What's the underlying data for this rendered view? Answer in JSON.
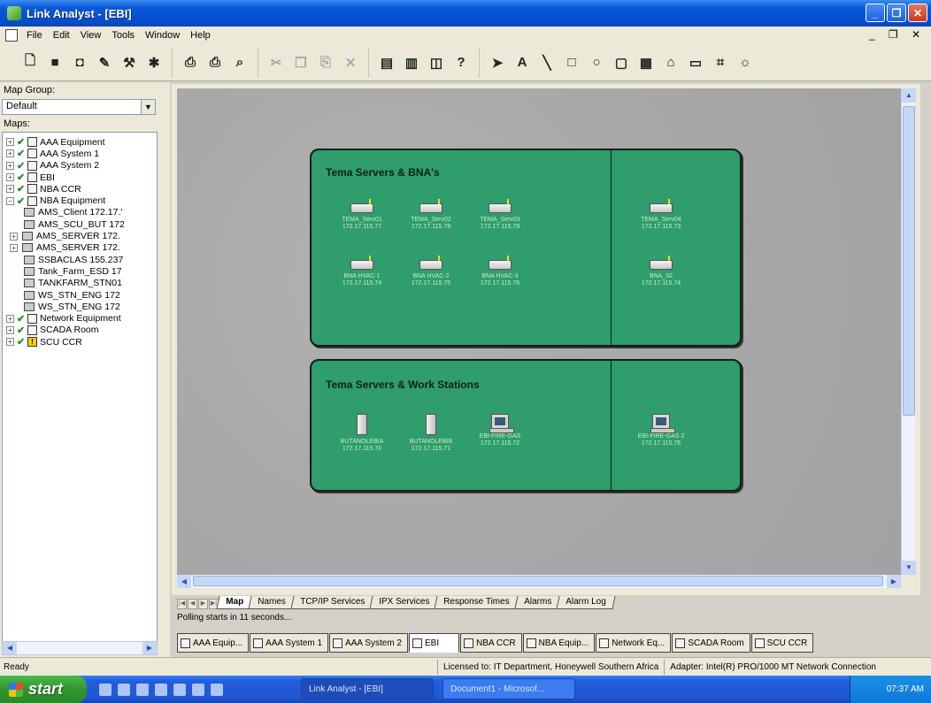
{
  "window": {
    "title": "Link Analyst - [EBI]",
    "buttons": [
      "_",
      "❐",
      "✕"
    ]
  },
  "menu": {
    "items": [
      "File",
      "Edit",
      "View",
      "Tools",
      "Window",
      "Help"
    ],
    "mdi_controls": "_ ❐ ✕"
  },
  "toolbar": {
    "groups": [
      [
        "new-icon",
        "save-icon",
        "open-icon",
        "wand-icon",
        "tools-icon",
        "discover-icon"
      ],
      [
        "print-setup-icon",
        "print-icon",
        "print-preview-icon"
      ],
      [
        "cut-icon",
        "copy-icon",
        "paste-icon",
        "delete-icon"
      ],
      [
        "layout1-icon",
        "layout2-icon",
        "layout3-icon",
        "properties-icon"
      ],
      [
        "pointer-icon",
        "text-icon",
        "line-icon",
        "rectangle-icon",
        "ellipse-icon",
        "rounded-rect-icon",
        "device-icon",
        "network-icon",
        "panel-icon",
        "grid-icon",
        "gear-icon"
      ]
    ]
  },
  "left_panel": {
    "map_group_label": "Map Group:",
    "map_group_value": "Default",
    "maps_label": "Maps:",
    "tree": [
      {
        "label": "AAA Equipment",
        "level": 0,
        "expander": "+",
        "type": "map",
        "checked": true
      },
      {
        "label": "AAA System 1",
        "level": 0,
        "expander": "+",
        "type": "map",
        "checked": true
      },
      {
        "label": "AAA System 2",
        "level": 0,
        "expander": "+",
        "type": "map",
        "checked": true
      },
      {
        "label": "EBI",
        "level": 0,
        "expander": "+",
        "type": "map",
        "checked": true
      },
      {
        "label": "NBA CCR",
        "level": 0,
        "expander": "+",
        "type": "map",
        "checked": true
      },
      {
        "label": "NBA Equipment",
        "level": 0,
        "expander": "−",
        "type": "map",
        "checked": true
      },
      {
        "label": "AMS_Client 172.17.'",
        "level": 1,
        "expander": "",
        "type": "device",
        "checked": false
      },
      {
        "label": "AMS_SCU_BUT 172",
        "level": 1,
        "expander": "",
        "type": "device",
        "checked": false
      },
      {
        "label": "AMS_SERVER 172.",
        "level": 1,
        "expander": "+",
        "type": "device",
        "checked": false
      },
      {
        "label": "AMS_SERVER 172.",
        "level": 1,
        "expander": "+",
        "type": "device",
        "checked": false
      },
      {
        "label": "SSBACLAS 155.237",
        "level": 1,
        "expander": "",
        "type": "device",
        "checked": false
      },
      {
        "label": "Tank_Farm_ESD 17",
        "level": 1,
        "expander": "",
        "type": "device",
        "checked": false
      },
      {
        "label": "TANKFARM_STN01",
        "level": 1,
        "expander": "",
        "type": "device",
        "checked": false
      },
      {
        "label": "WS_STN_ENG 172",
        "level": 1,
        "expander": "",
        "type": "device",
        "checked": false
      },
      {
        "label": "WS_STN_ENG 172",
        "level": 1,
        "expander": "",
        "type": "device",
        "checked": false
      },
      {
        "label": "Network Equipment",
        "level": 0,
        "expander": "+",
        "type": "map",
        "checked": true
      },
      {
        "label": "SCADA Room",
        "level": 0,
        "expander": "+",
        "type": "map",
        "checked": true
      },
      {
        "label": "SCU CCR",
        "level": 0,
        "expander": "+",
        "type": "warn",
        "checked": true
      }
    ]
  },
  "map": {
    "panels": [
      {
        "title": "Tema Servers & BNA's",
        "left_devices": [
          {
            "name": "TEMA_Serv01",
            "ip": "172.17.115.77",
            "icon": "server-box-icon"
          },
          {
            "name": "TEMA_Serv02",
            "ip": "172.17.115.78",
            "icon": "server-box-icon"
          },
          {
            "name": "TEMA_Serv03",
            "ip": "172.17.115.79",
            "icon": "server-box-icon"
          },
          {
            "name": "BNA HVAC-1",
            "ip": "172.17.115.74",
            "icon": "server-box-icon"
          },
          {
            "name": "BNA HVAC-2",
            "ip": "172.17.115.75",
            "icon": "server-box-icon"
          },
          {
            "name": "BNA HVAC-3",
            "ip": "172.17.115.76",
            "icon": "server-box-icon"
          }
        ],
        "right_devices": [
          {
            "name": "TEMA_Serv04",
            "ip": "172.17.115.73",
            "icon": "server-box-icon"
          },
          {
            "name": "BNA_02",
            "ip": "172.17.115.74",
            "icon": "server-box-icon"
          }
        ]
      },
      {
        "title": "Tema Servers & Work Stations",
        "left_devices": [
          {
            "name": "BUTANOLEBIA",
            "ip": "172.17.115.70",
            "icon": "tower-icon"
          },
          {
            "name": "BUTANOLEBIB",
            "ip": "172.17.115.71",
            "icon": "tower-icon"
          },
          {
            "name": "EBI-FIRE-GAS",
            "ip": "172.17.115.72",
            "icon": "workstation-icon"
          }
        ],
        "right_devices": [
          {
            "name": "EBI-FIRE-GAS 2",
            "ip": "172.17.115.76",
            "icon": "workstation-icon"
          }
        ]
      }
    ]
  },
  "sheet_tabs": {
    "active": "Map",
    "tabs": [
      "Map",
      "Names",
      "TCP/IP Services",
      "IPX Services",
      "Response Times",
      "Alarms",
      "Alarm Log"
    ]
  },
  "polling_text": "Polling starts in 11 seconds...",
  "window_tabs": {
    "active": "EBI",
    "tabs": [
      "AAA Equip...",
      "AAA System 1",
      "AAA System 2",
      "EBI",
      "NBA CCR",
      "NBA Equip...",
      "Network Eq...",
      "SCADA Room",
      "SCU CCR"
    ]
  },
  "status": {
    "ready": "Ready",
    "license": "Licensed to: IT Department, Honeywell Southern Africa",
    "adapter": "Adapter: Intel(R) PRO/1000 MT Network Connection"
  },
  "taskbar": {
    "start_label": "start",
    "tasks": [
      {
        "label": "Link Analyst - [EBI]",
        "pressed": true
      },
      {
        "label": "Document1 - Microsof...",
        "pressed": false
      }
    ],
    "clock": "07:37 AM"
  }
}
